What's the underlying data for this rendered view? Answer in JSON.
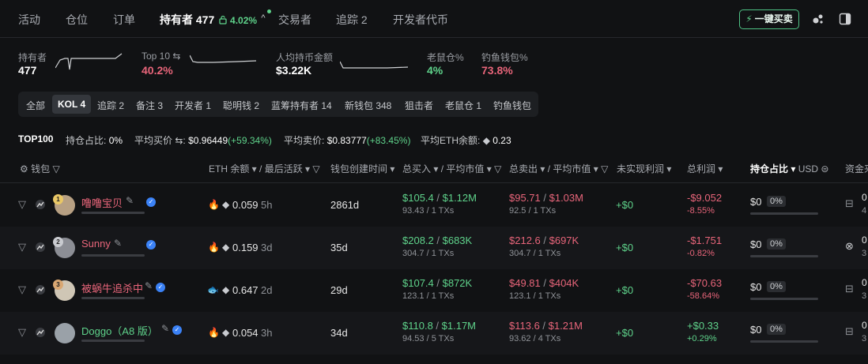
{
  "tabs": [
    {
      "label": "活动"
    },
    {
      "label": "仓位"
    },
    {
      "label": "订单"
    },
    {
      "label": "持有者 477",
      "pct": "4.02%"
    },
    {
      "label": "交易者"
    },
    {
      "label": "追踪 2"
    },
    {
      "label": "开发者代币"
    }
  ],
  "toolbar": {
    "one_click": "一键买卖"
  },
  "stats": {
    "holders_label": "持有者",
    "holders_value": "477",
    "top10_label": "Top 10",
    "top10_value": "40.2%",
    "avg_label": "人均持币金额",
    "avg_value": "$3.22K",
    "rat_label": "老鼠仓%",
    "rat_value": "4%",
    "phish_label": "钓鱼钱包%",
    "phish_value": "73.8%"
  },
  "filters": [
    "全部",
    "KOL 4",
    "追踪 2",
    "备注 3",
    "开发者 1",
    "聪明钱 2",
    "蓝筹持有者 14",
    "新钱包 348",
    "狙击者",
    "老鼠仓 1",
    "钓鱼钱包"
  ],
  "summary": {
    "top": "TOP100",
    "hold_label": "持仓占比:",
    "hold_value": "0%",
    "buy_label": "平均买价",
    "buy_value": "$0.96449",
    "buy_pct": "(+59.34%)",
    "sell_label": "平均卖价:",
    "sell_value": "$0.83777",
    "sell_pct": "(+83.45%)",
    "eth_label": "平均ETH余额:",
    "eth_value": "0.23"
  },
  "headers": {
    "wallet": "钱包",
    "eth": "ETH 余额",
    "last": "最后活跃",
    "created": "钱包创建时间",
    "buy": "总买入",
    "buy_mcap": "平均市值",
    "sell": "总卖出",
    "sell_mcap": "平均市值",
    "unreal": "未实现利润",
    "profit": "总利润",
    "holding": "持仓占比",
    "usd": "USD",
    "fund": "资金来"
  },
  "rows": [
    {
      "rank": "1",
      "name": "噜噜宝贝",
      "eth": "0.059",
      "last": "5h",
      "created": "2861d",
      "buy": "$105.4",
      "buy_mcap": "$1.12M",
      "buy_sub": "93.43 / 1 TXs",
      "sell": "$95.71",
      "sell_mcap": "$1.03M",
      "sell_sub": "92.5 / 1 TXs",
      "unreal": "+$0",
      "profit": "-$9.052",
      "profit_pct": "-8.55%",
      "hold": "$0",
      "hold_pct": "0%"
    },
    {
      "rank": "2",
      "name": "Sunny",
      "eth": "0.159",
      "last": "3d",
      "created": "35d",
      "buy": "$208.2",
      "buy_mcap": "$683K",
      "buy_sub": "304.7 / 1 TXs",
      "sell": "$212.6",
      "sell_mcap": "$697K",
      "sell_sub": "304.7 / 1 TXs",
      "unreal": "+$0",
      "profit": "-$1.751",
      "profit_pct": "-0.82%",
      "hold": "$0",
      "hold_pct": "0%"
    },
    {
      "rank": "3",
      "name": "被蜗牛追杀中",
      "eth": "0.647",
      "last": "2d",
      "created": "29d",
      "buy": "$107.4",
      "buy_mcap": "$872K",
      "buy_sub": "123.1 / 1 TXs",
      "sell": "$49.81",
      "sell_mcap": "$404K",
      "sell_sub": "123.1 / 1 TXs",
      "unreal": "+$0",
      "profit": "-$70.63",
      "profit_pct": "-58.64%",
      "hold": "$0",
      "hold_pct": "0%"
    },
    {
      "rank": "",
      "name": "Doggo（A8 版）",
      "eth": "0.054",
      "last": "3h",
      "created": "34d",
      "buy": "$110.8",
      "buy_mcap": "$1.17M",
      "buy_sub": "94.53 / 5 TXs",
      "sell": "$113.6",
      "sell_mcap": "$1.21M",
      "sell_sub": "93.62 / 4 TXs",
      "unreal": "+$0",
      "profit": "+$0.33",
      "profit_pct": "+0.29%",
      "hold": "$0",
      "hold_pct": "0%"
    }
  ],
  "edge_chars": [
    "0",
    "4",
    "0",
    "3",
    "0",
    "3",
    "0",
    "3"
  ]
}
